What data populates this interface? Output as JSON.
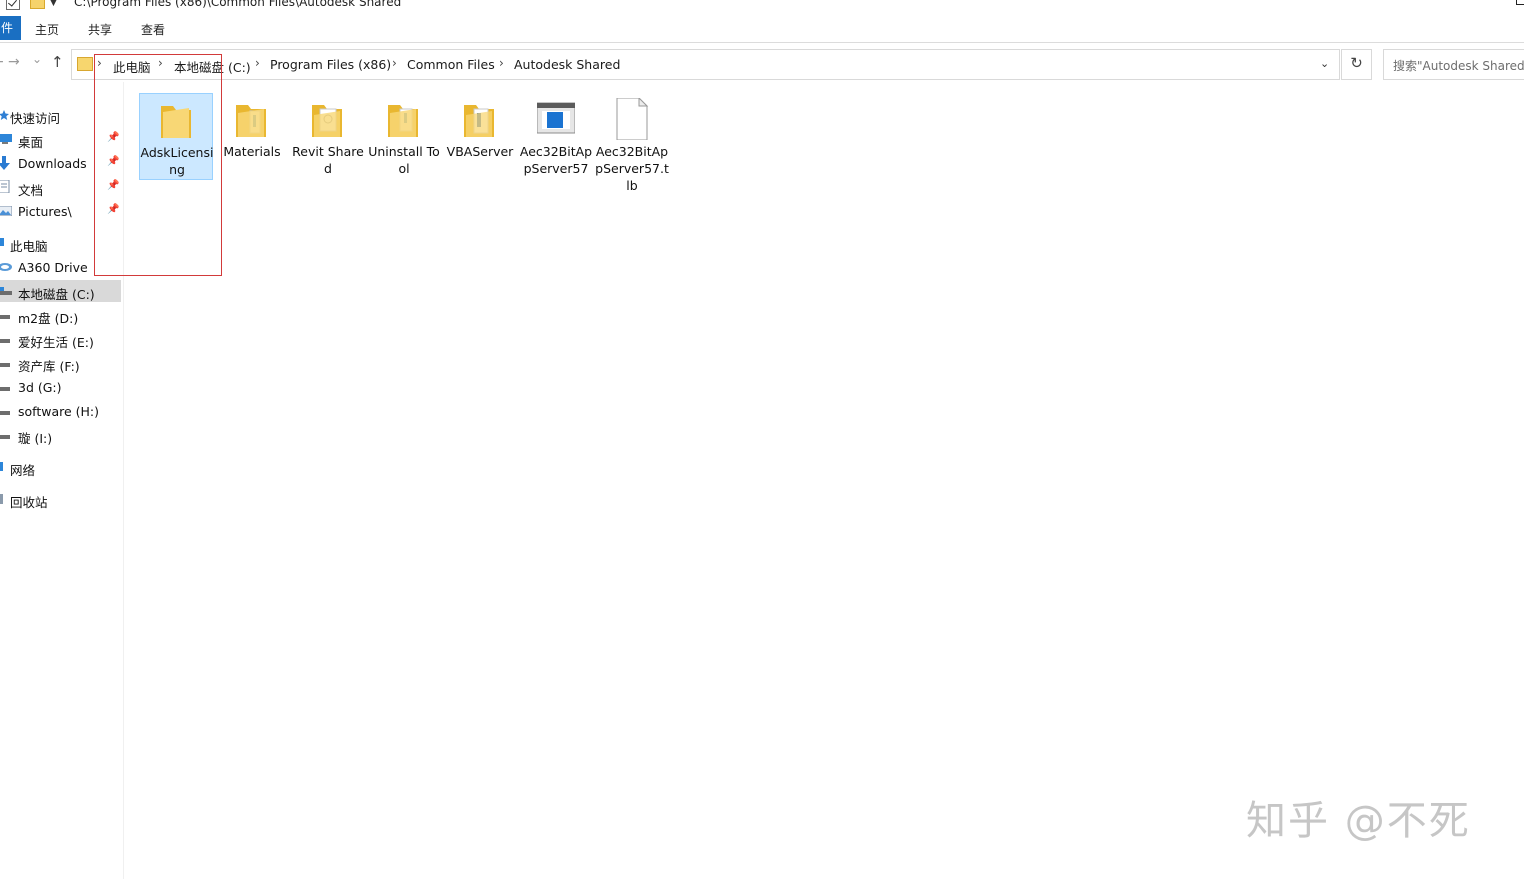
{
  "window": {
    "title": "C:\\Program Files (x86)\\Common Files\\Autodesk Shared"
  },
  "ribbon": {
    "file_tab": "件",
    "tabs": [
      "主页",
      "共享",
      "查看"
    ]
  },
  "nav_buttons": {
    "back": "←",
    "forward": "→",
    "recent": "⌄",
    "up": "↑",
    "refresh": "↻",
    "dropdown": "⌄"
  },
  "address": {
    "crumbs": [
      "此电脑",
      "本地磁盘 (C:)",
      "Program Files (x86)",
      "Common Files",
      "Autodesk Shared"
    ]
  },
  "search": {
    "placeholder": "搜索\"Autodesk Shared\""
  },
  "sidebar": {
    "items": [
      {
        "label": "快速访问",
        "icon": "star-icon"
      },
      {
        "label": "桌面",
        "icon": "desktop-icon",
        "pinned": true
      },
      {
        "label": "Downloads",
        "icon": "download-icon",
        "pinned": true
      },
      {
        "label": "文档",
        "icon": "document-icon",
        "pinned": true
      },
      {
        "label": "Pictures\\",
        "icon": "pictures-icon",
        "pinned": true
      },
      {
        "label": "此电脑",
        "icon": "computer-icon"
      },
      {
        "label": "A360 Drive",
        "icon": "cloud-drive-icon"
      },
      {
        "label": "本地磁盘 (C:)",
        "icon": "drive-icon",
        "selected": true
      },
      {
        "label": "m2盘 (D:)",
        "icon": "drive-icon"
      },
      {
        "label": "爱好生活 (E:)",
        "icon": "drive-icon"
      },
      {
        "label": "资产库 (F:)",
        "icon": "drive-icon"
      },
      {
        "label": "3d (G:)",
        "icon": "drive-icon"
      },
      {
        "label": "software (H:)",
        "icon": "drive-icon"
      },
      {
        "label": "璇 (I:)",
        "icon": "drive-icon"
      },
      {
        "label": "网络",
        "icon": "network-icon"
      },
      {
        "label": "回收站",
        "icon": "recycle-bin-icon"
      }
    ],
    "pin_glyph": "📌"
  },
  "files": [
    {
      "label": "AdskLicensing",
      "type": "folder",
      "selected": true
    },
    {
      "label": "Materials",
      "type": "folder"
    },
    {
      "label": "Revit Shared",
      "type": "folder"
    },
    {
      "label": "Uninstall Tool",
      "type": "folder"
    },
    {
      "label": "VBAServer",
      "type": "folder"
    },
    {
      "label": "Aec32BitAppServer57",
      "type": "exe"
    },
    {
      "label": "Aec32BitAppServer57.tlb",
      "type": "file"
    }
  ],
  "watermark": "知乎 @不死",
  "colors": {
    "accent": "#1a6fc2",
    "selection": "#cce8ff",
    "highlight_box": "#d23a3a",
    "folder": "#f6d36b"
  }
}
